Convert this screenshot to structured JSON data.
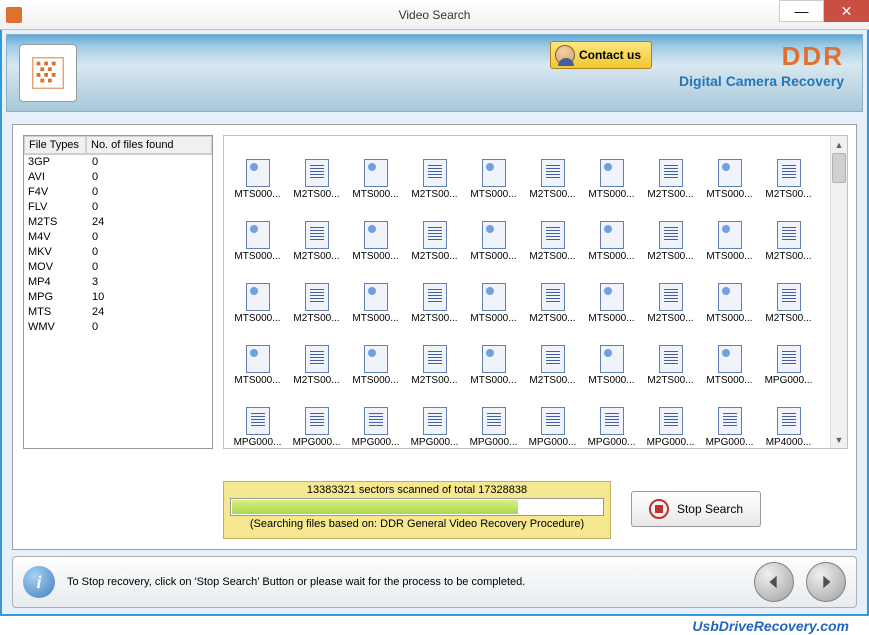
{
  "title": "Video Search",
  "header": {
    "contact_label": "Contact us",
    "brand_logo": "DDR",
    "brand_sub": "Digital Camera Recovery"
  },
  "file_types": {
    "col1": "File Types",
    "col2": "No. of files found",
    "rows": [
      {
        "type": "3GP",
        "count": 0
      },
      {
        "type": "AVI",
        "count": 0
      },
      {
        "type": "F4V",
        "count": 0
      },
      {
        "type": "FLV",
        "count": 0
      },
      {
        "type": "M2TS",
        "count": 24
      },
      {
        "type": "M4V",
        "count": 0
      },
      {
        "type": "MKV",
        "count": 0
      },
      {
        "type": "MOV",
        "count": 0
      },
      {
        "type": "MP4",
        "count": 3
      },
      {
        "type": "MPG",
        "count": 10
      },
      {
        "type": "MTS",
        "count": 24
      },
      {
        "type": "WMV",
        "count": 0
      }
    ]
  },
  "files": {
    "row1": [
      "MTS000...",
      "M2TS00...",
      "MTS000...",
      "M2TS00...",
      "MTS000...",
      "M2TS00...",
      "MTS000...",
      "M2TS00...",
      "MTS000...",
      "M2TS00..."
    ],
    "row2": [
      "MTS000...",
      "M2TS00...",
      "MTS000...",
      "M2TS00...",
      "MTS000...",
      "M2TS00...",
      "MTS000...",
      "M2TS00...",
      "MTS000...",
      "M2TS00..."
    ],
    "row3": [
      "MTS000...",
      "M2TS00...",
      "MTS000...",
      "M2TS00...",
      "MTS000...",
      "M2TS00...",
      "MTS000...",
      "M2TS00...",
      "MTS000...",
      "M2TS00..."
    ],
    "row4": [
      "MTS000...",
      "M2TS00...",
      "MTS000...",
      "M2TS00...",
      "MTS000...",
      "M2TS00...",
      "MTS000...",
      "M2TS00...",
      "MTS000...",
      "MPG000..."
    ],
    "row5": [
      "MPG000...",
      "MPG000...",
      "MPG000...",
      "MPG000...",
      "MPG000...",
      "MPG000...",
      "MPG000...",
      "MPG000...",
      "MPG000...",
      "MP4000..."
    ]
  },
  "progress": {
    "sectors_text": "13383321 sectors scanned of total 17328838",
    "percent": 77,
    "procedure_text": "(Searching files based on:  DDR General Video Recovery Procedure)"
  },
  "stop_label": "Stop Search",
  "footer_text": "To Stop recovery, click on 'Stop Search' Button or please wait for the process to be completed.",
  "watermark": "UsbDriveRecovery.com"
}
